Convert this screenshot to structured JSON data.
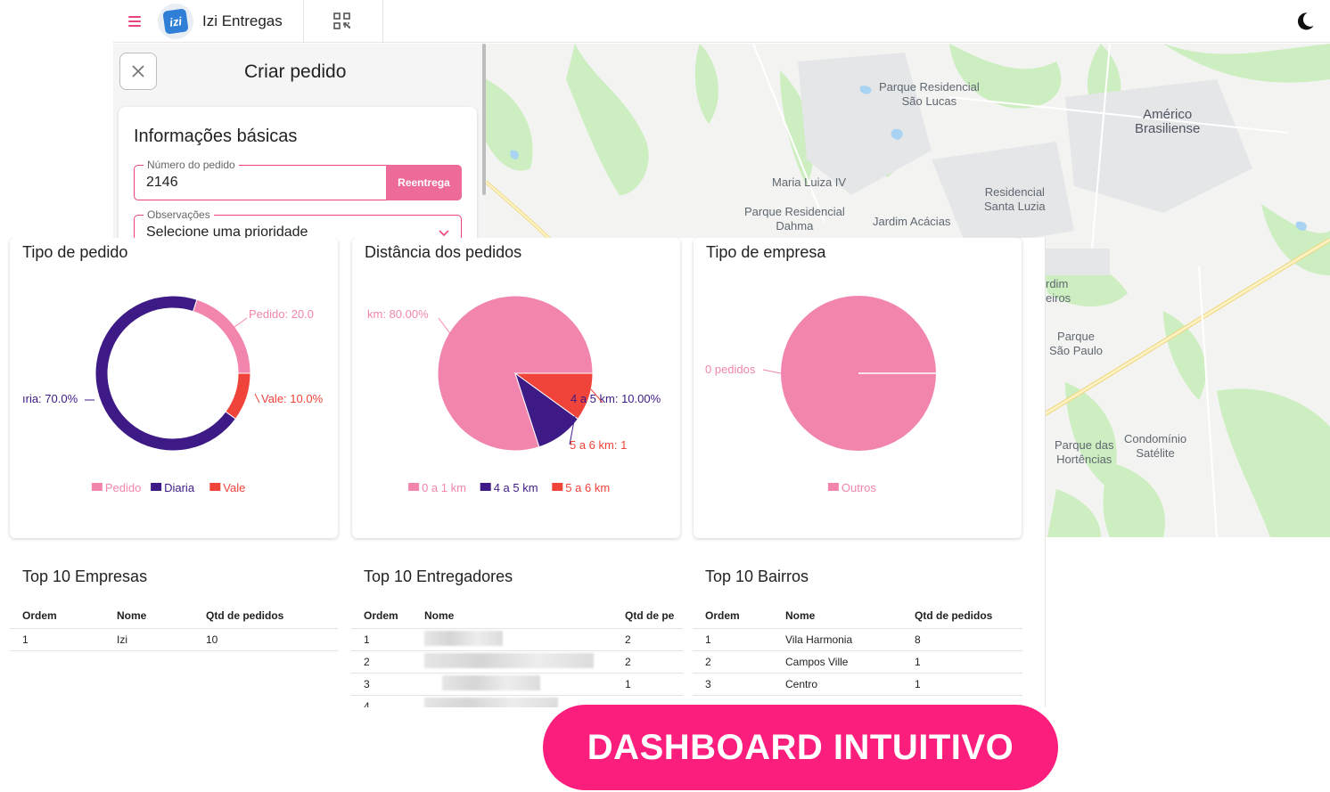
{
  "app": {
    "name": "Izi Entregas",
    "logo_text": "izi"
  },
  "panel": {
    "title": "Criar pedido",
    "section_title": "Informações básicas",
    "order_number": {
      "label": "Número do pedido",
      "value": "2146",
      "button": "Reentrega"
    },
    "observations": {
      "label": "Observações",
      "value": "Selecione uma prioridade"
    }
  },
  "map": {
    "labels": [
      "Parque Residencial\nSão Lucas",
      "Américo\nBrasiliense",
      "Maria Luiza IV",
      "Residencial\nSanta Luzia",
      "Parque Residencial\nDahma",
      "Jardim Acácias",
      "rdim\neiros",
      "Parque\nSão Paulo",
      "Parque das\nHortências",
      "Condomínio\nSatélite"
    ]
  },
  "colors": {
    "pink": "#f285ae",
    "purple": "#3d1a85",
    "red": "#f0433a",
    "accent": "#e8437f",
    "promo": "#fb1e7d"
  },
  "chart_data": [
    {
      "type": "pie",
      "variant": "donut",
      "title": "Tipo de pedido",
      "categories": [
        "Pedido",
        "Diaria",
        "Vale"
      ],
      "values": [
        20,
        70,
        10
      ],
      "colors": [
        "#f285ae",
        "#3d1a85",
        "#f0433a"
      ],
      "data_labels": [
        "Pedido: 20.0",
        "ıria: 70.0%",
        "Vale: 10.0%"
      ],
      "legend": "bottom"
    },
    {
      "type": "pie",
      "title": "Distância dos pedidos",
      "categories": [
        "0 a 1 km",
        "4 a 5 km",
        "5 a 6 km"
      ],
      "values": [
        80,
        10,
        10
      ],
      "colors": [
        "#f285ae",
        "#3d1a85",
        "#f0433a"
      ],
      "data_labels": [
        "km: 80.00%",
        "4 a 5 km: 10.00%",
        "5 a 6 km: 1"
      ],
      "legend": "bottom"
    },
    {
      "type": "pie",
      "title": "Tipo de empresa",
      "categories": [
        "Outros"
      ],
      "values": [
        100
      ],
      "colors": [
        "#f285ae"
      ],
      "data_labels": [
        "0 pedidos"
      ],
      "legend": "bottom"
    }
  ],
  "tables": {
    "empresas": {
      "title": "Top 10 Empresas",
      "headers": [
        "Ordem",
        "Nome",
        "Qtd de pedidos"
      ],
      "rows": [
        [
          "1",
          "Izi",
          "10"
        ]
      ]
    },
    "entregadores": {
      "title": "Top 10 Entregadores",
      "headers": [
        "Ordem",
        "Nome",
        "Qtd de pe"
      ],
      "rows": [
        [
          "1",
          "",
          "2"
        ],
        [
          "2",
          "",
          "2"
        ],
        [
          "3",
          "",
          "1"
        ],
        [
          "4",
          "",
          ""
        ]
      ]
    },
    "bairros": {
      "title": "Top 10 Bairros",
      "headers": [
        "Ordem",
        "Nome",
        "Qtd de pedidos"
      ],
      "rows": [
        [
          "1",
          "Vila Harmonia",
          "8"
        ],
        [
          "2",
          "Campos Ville",
          "1"
        ],
        [
          "3",
          "Centro",
          "1"
        ]
      ]
    }
  },
  "promo": {
    "text": "DASHBOARD INTUITIVO"
  }
}
